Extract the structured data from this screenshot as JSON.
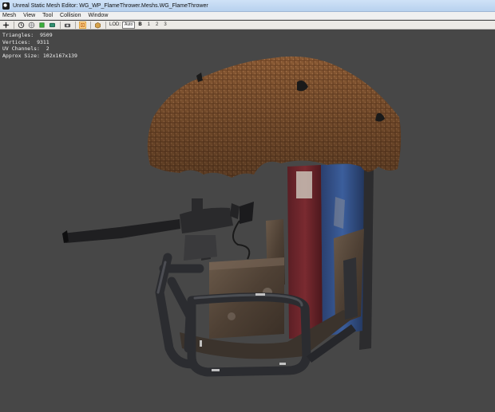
{
  "window": {
    "title": "Unreal Static Mesh Editor: WG_WP_FlameThrower.Meshs.WG_FlameThrower",
    "app_icon": "unreal-icon"
  },
  "menu": {
    "items": [
      {
        "label": "Mesh"
      },
      {
        "label": "View"
      },
      {
        "label": "Tool"
      },
      {
        "label": "Collision"
      },
      {
        "label": "Window"
      }
    ]
  },
  "toolbar": {
    "lod_label": "LOD:",
    "auto_label": "Auto",
    "lod_levels": [
      "B",
      "1",
      "2",
      "3"
    ],
    "icons": [
      "pivot-icon",
      "realtime-icon",
      "wireframe-icon",
      "green-dot-icon",
      "collision-icon",
      "camera-icon",
      "active-view-icon",
      "box-icon"
    ]
  },
  "viewport": {
    "stats": {
      "triangles_label": "Triangles:",
      "triangles": "9509",
      "vertices_label": "Vertices:",
      "vertices": "9311",
      "uv_channels_label": "UV Channels:",
      "uv_channels": "2",
      "approx_size_label": "Approx Size:",
      "approx_size": "102x167x139"
    },
    "background_color": "#474747"
  }
}
